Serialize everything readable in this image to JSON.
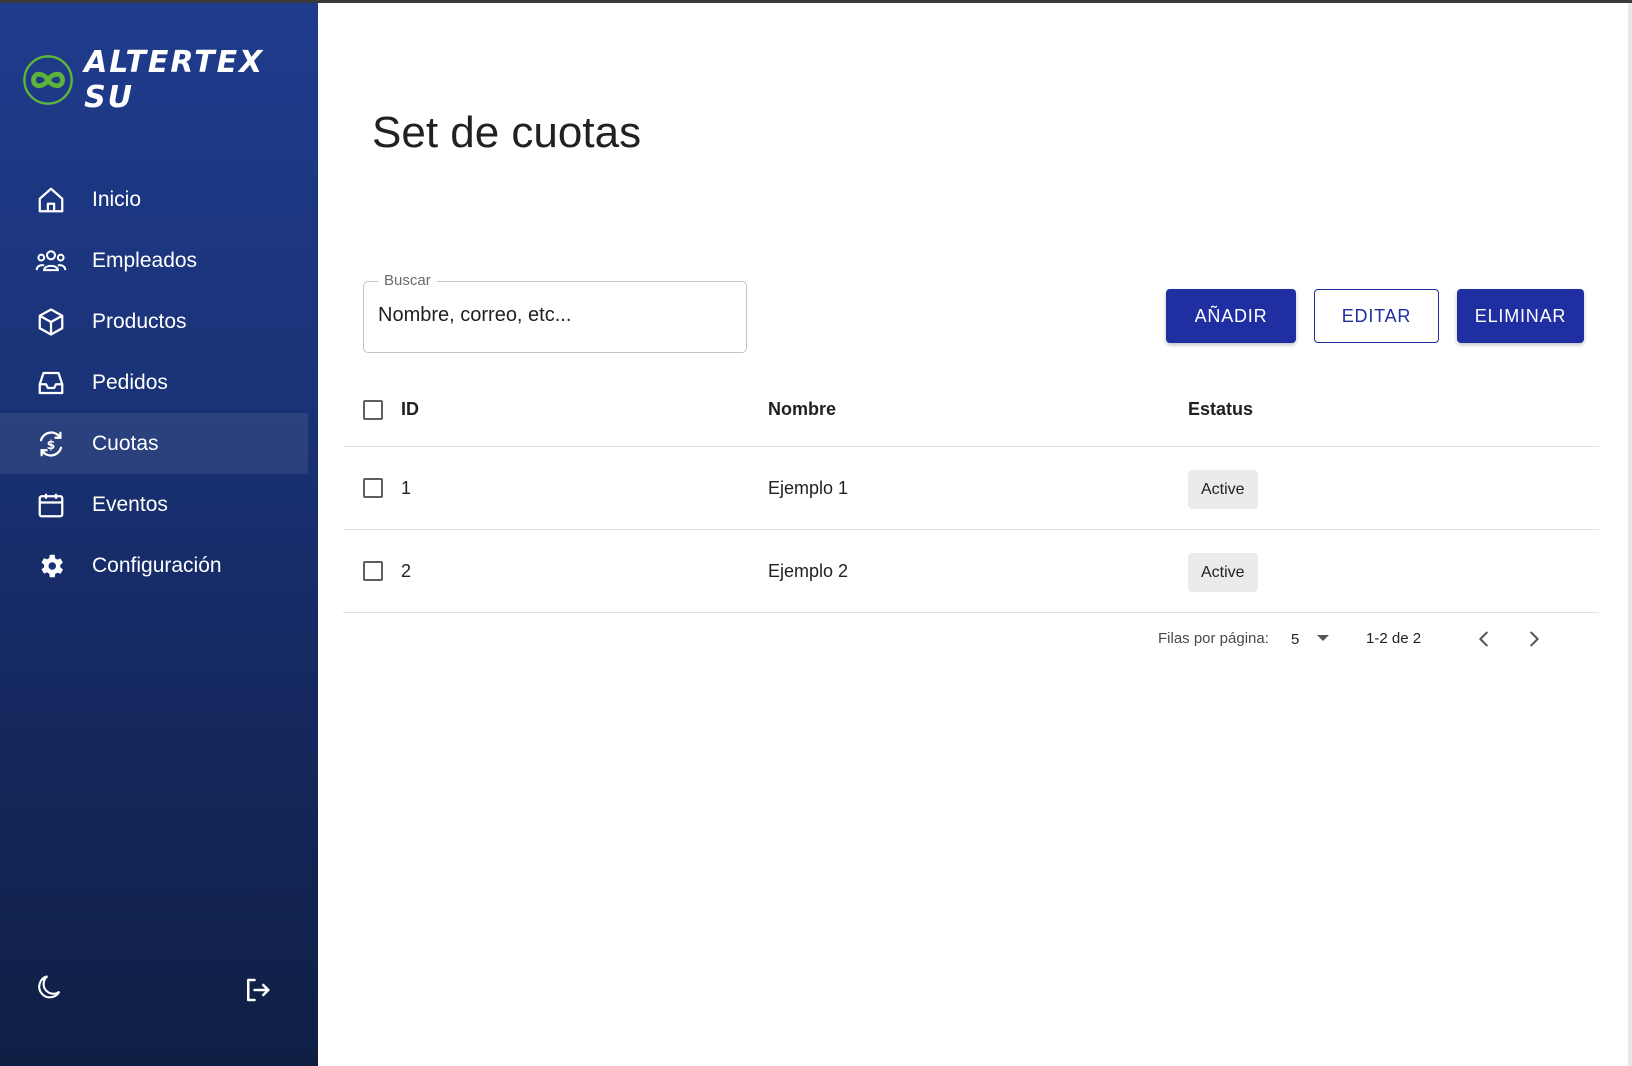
{
  "brand": {
    "name": "ALTERTEX SU"
  },
  "sidebar": {
    "items": [
      {
        "label": "Inicio",
        "icon": "home-icon"
      },
      {
        "label": "Empleados",
        "icon": "people-icon"
      },
      {
        "label": "Productos",
        "icon": "box-icon"
      },
      {
        "label": "Pedidos",
        "icon": "inbox-icon"
      },
      {
        "label": "Cuotas",
        "icon": "currency-exchange-icon",
        "active": true
      },
      {
        "label": "Eventos",
        "icon": "calendar-icon"
      },
      {
        "label": "Configuración",
        "icon": "gear-icon"
      }
    ],
    "bottom": {
      "theme_icon": "moon-icon",
      "logout_icon": "logout-icon"
    }
  },
  "main": {
    "title": "Set de cuotas",
    "search": {
      "label": "Buscar",
      "placeholder": "Nombre, correo, etc..."
    },
    "actions": {
      "add": "AÑADIR",
      "edit": "EDITAR",
      "delete": "ELIMINAR"
    },
    "table": {
      "columns": {
        "id": "ID",
        "name": "Nombre",
        "status": "Estatus"
      },
      "rows": [
        {
          "id": "1",
          "name": "Ejemplo 1",
          "status": "Active"
        },
        {
          "id": "2",
          "name": "Ejemplo 2",
          "status": "Active"
        }
      ]
    },
    "pagination": {
      "rows_per_page_label": "Filas por página:",
      "rows_per_page": "5",
      "range": "1-2 de 2"
    }
  },
  "colors": {
    "sidebar_top": "#1f3b8c",
    "sidebar_bottom": "#0f1f44",
    "primary": "#1f2ea0",
    "logo_green": "#5fb33a"
  }
}
